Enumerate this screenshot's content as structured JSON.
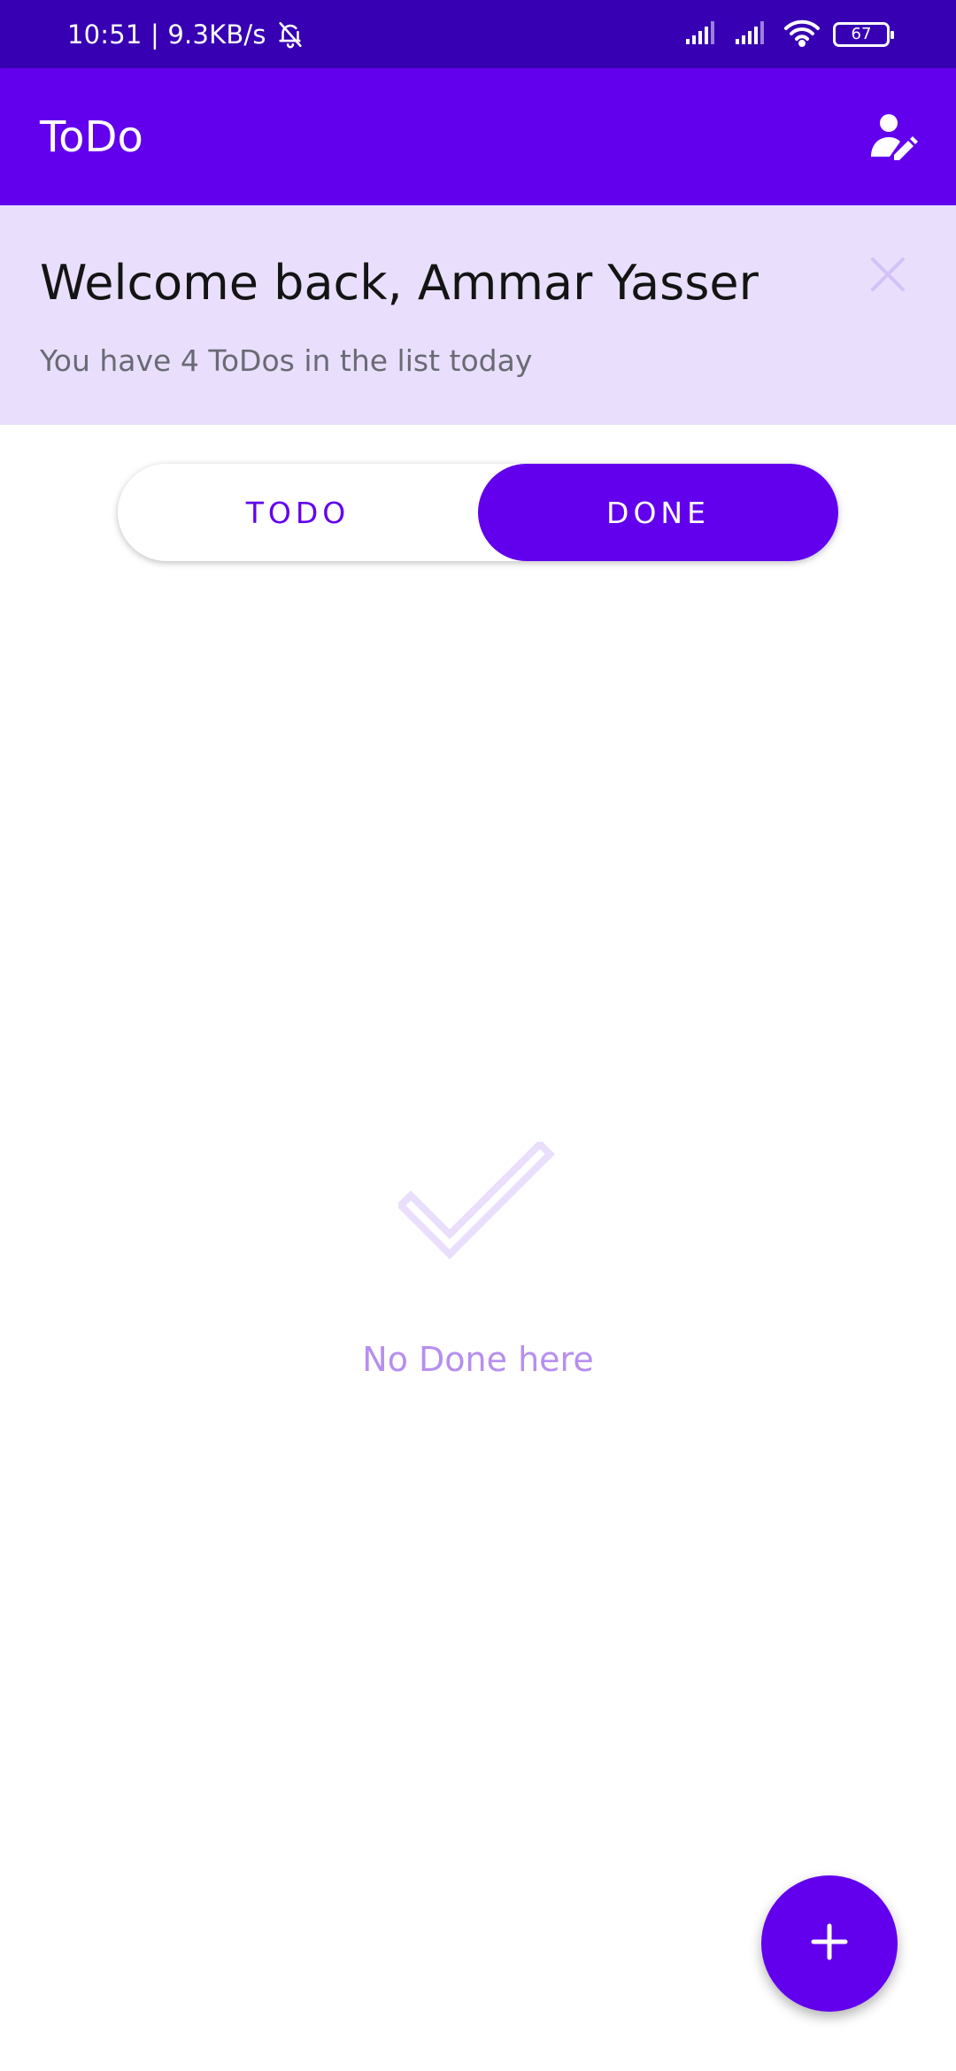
{
  "status_bar": {
    "time_speed": "10:51 | 9.3KB/s",
    "battery_level": "67",
    "icons": [
      "bell-off-icon",
      "signal-icon",
      "signal-icon",
      "wifi-icon",
      "battery-icon"
    ]
  },
  "app_bar": {
    "title": "ToDo",
    "profile_icon": "edit-profile-icon"
  },
  "banner": {
    "welcome": "Welcome back, Ammar Yasser",
    "subtitle": "You have 4 ToDos in the list today",
    "close_icon": "close-icon"
  },
  "tabs": {
    "todo_label": "TODO",
    "done_label": "DONE",
    "selected": "DONE"
  },
  "empty_state": {
    "icon": "checkmark-icon",
    "message": "No Done here"
  },
  "fab": {
    "icon": "plus-icon"
  },
  "colors": {
    "primary": "#6200ee",
    "primary_dark": "#3700b3",
    "banner_bg": "#e9dffc",
    "empty_text": "#b68ef0"
  }
}
